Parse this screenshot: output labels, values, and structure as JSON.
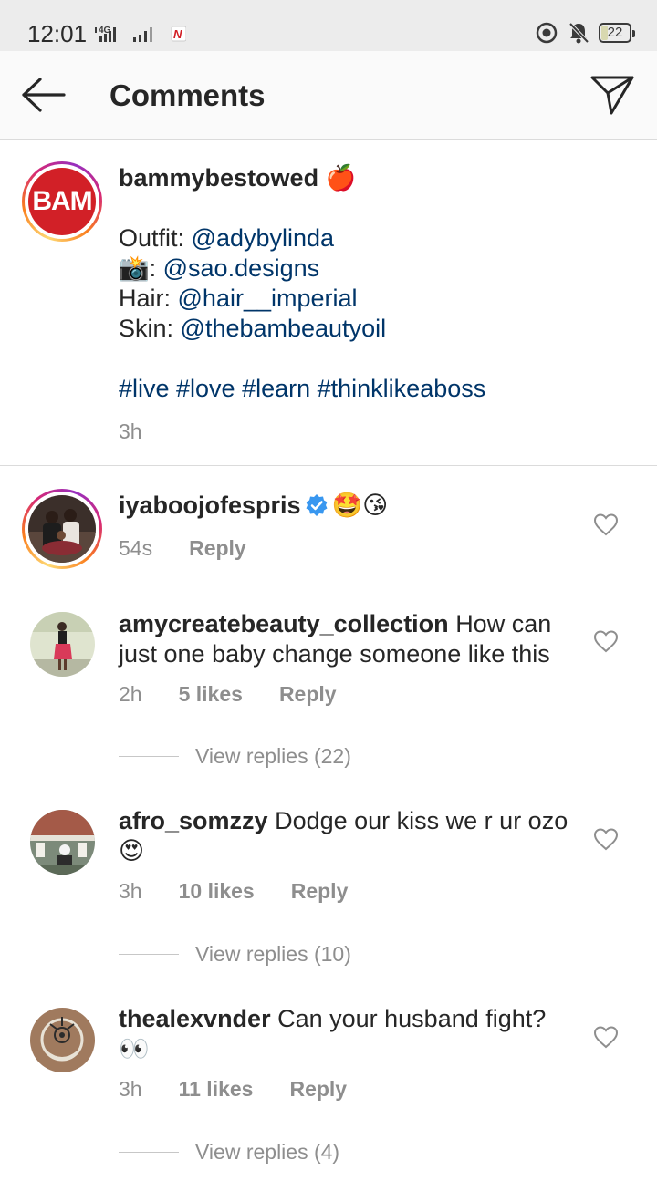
{
  "status_bar": {
    "time": "12:01",
    "network": "4G",
    "battery": "22"
  },
  "header": {
    "title": "Comments",
    "back_icon": "arrow-left-icon",
    "send_icon": "paper-plane-icon"
  },
  "caption": {
    "avatar_text": "BAM",
    "username": "bammybestowed",
    "username_emoji": "🍎",
    "lines": [
      {
        "prefix": "Outfit: ",
        "mention": "@adybylinda"
      },
      {
        "prefix": "📸: ",
        "mention": "@sao.designs"
      },
      {
        "prefix": "Hair: ",
        "mention": "@hair__imperial"
      },
      {
        "prefix": "Skin: ",
        "mention": "@thebambeautyoil"
      }
    ],
    "hashtags": "#live #love #learn #thinklikeaboss",
    "time": "3h"
  },
  "comments": [
    {
      "username": "iyaboojofespris",
      "verified": true,
      "text": "🤩😘",
      "time": "54s",
      "likes": "",
      "reply": "Reply",
      "view_replies": ""
    },
    {
      "username": "amycreatebeauty_collection",
      "text": "How can just one baby change someone like this",
      "time": "2h",
      "likes": "5 likes",
      "reply": "Reply",
      "view_replies": "View replies (22)"
    },
    {
      "username": "afro_somzzy",
      "text": "Dodge our kiss we r ur ozo 😍",
      "time": "3h",
      "likes": "10 likes",
      "reply": "Reply",
      "view_replies": "View replies (10)"
    },
    {
      "username": "thealexvnder",
      "text": "Can your husband fight? 👀",
      "time": "3h",
      "likes": "11 likes",
      "reply": "Reply",
      "view_replies": "View replies (4)"
    }
  ],
  "colors": {
    "mention": "#003569",
    "secondary_text": "#8e8e8e",
    "verified": "#3897f0",
    "brand_red": "#d22027"
  }
}
